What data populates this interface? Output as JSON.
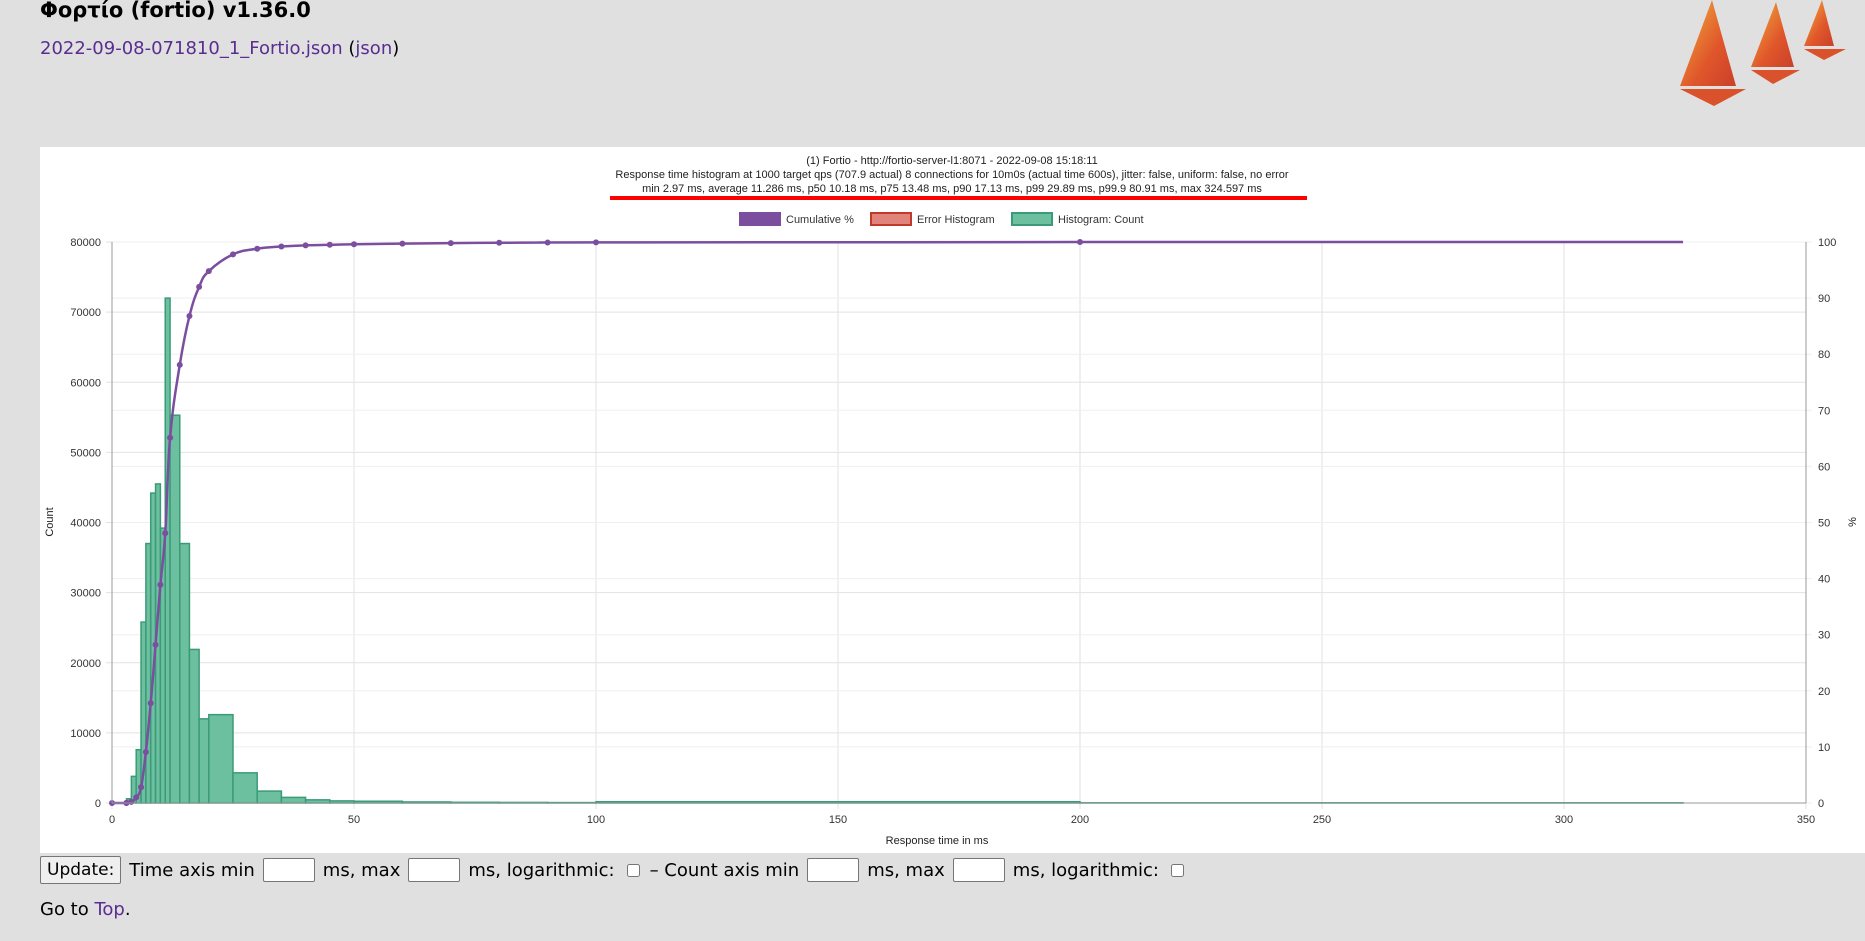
{
  "header": {
    "title": "Φορτίο (fortio) v1.36.0",
    "file_link": "2022-09-08-071810_1_Fortio.json",
    "json_prefix": " (",
    "json_link": "json",
    "json_suffix": ")"
  },
  "controls": {
    "update_label": "Update:",
    "time_min_label": "Time axis min",
    "time_max_label": "ms, max",
    "time_log_label": "ms, logarithmic:",
    "separator": "– Count axis min",
    "count_max_label": "ms, max",
    "count_log_label": "ms, logarithmic:"
  },
  "footer": {
    "goto_text": "Go to ",
    "top_link": "Top",
    "goto_end": "."
  },
  "colors": {
    "cumulative": "#7b4ea0",
    "histogram_fill": "#6cbf9f",
    "histogram_border": "#3b9b78",
    "error_fill": "#e0847b",
    "error_border": "#c0392b",
    "highlight_line": "#ff0000",
    "link": "#5a2d91"
  },
  "chart_data": {
    "type": "bar",
    "title_lines": [
      "(1) Fortio - http://fortio-server-l1:8071 - 2022-09-08 15:18:11",
      "Response time histogram at 1000 target qps (707.9 actual) 8 connections for 10m0s (actual time 600s), jitter: false, uniform: false, no error",
      "min 2.97 ms, average 11.286 ms, p50 10.18 ms, p75 13.48 ms, p90 17.13 ms, p99 29.89 ms, p99.9 80.91 ms, max 324.597 ms"
    ],
    "legend": [
      "Cumulative %",
      "Error Histogram",
      "Histogram: Count"
    ],
    "legend_position": "top",
    "xlabel": "Response time in ms",
    "ylabel": "Count",
    "y2label": "%",
    "xlim": [
      0,
      350
    ],
    "ylim": [
      0,
      80000
    ],
    "y2lim": [
      0,
      100
    ],
    "x_ticks": [
      0,
      50,
      100,
      150,
      200,
      250,
      300,
      350
    ],
    "y_ticks": [
      0,
      10000,
      20000,
      30000,
      40000,
      50000,
      60000,
      70000,
      80000
    ],
    "y2_ticks": [
      0,
      10,
      20,
      30,
      40,
      50,
      60,
      70,
      80,
      90,
      100
    ],
    "grid": true,
    "histogram_count": [
      {
        "x0": 2.97,
        "x1": 3,
        "y": 200
      },
      {
        "x0": 3,
        "x1": 4,
        "y": 600
      },
      {
        "x0": 4,
        "x1": 5,
        "y": 3800
      },
      {
        "x0": 5,
        "x1": 6,
        "y": 7600
      },
      {
        "x0": 6,
        "x1": 7,
        "y": 25800
      },
      {
        "x0": 7,
        "x1": 8,
        "y": 37000
      },
      {
        "x0": 8,
        "x1": 9,
        "y": 44200
      },
      {
        "x0": 9,
        "x1": 10,
        "y": 45500
      },
      {
        "x0": 10,
        "x1": 11,
        "y": 39200
      },
      {
        "x0": 11,
        "x1": 12,
        "y": 72000
      },
      {
        "x0": 12,
        "x1": 14,
        "y": 55300
      },
      {
        "x0": 14,
        "x1": 16,
        "y": 37000
      },
      {
        "x0": 16,
        "x1": 18,
        "y": 21900
      },
      {
        "x0": 18,
        "x1": 20,
        "y": 12000
      },
      {
        "x0": 20,
        "x1": 25,
        "y": 12600
      },
      {
        "x0": 25,
        "x1": 30,
        "y": 4300
      },
      {
        "x0": 30,
        "x1": 35,
        "y": 1700
      },
      {
        "x0": 35,
        "x1": 40,
        "y": 800
      },
      {
        "x0": 40,
        "x1": 45,
        "y": 450
      },
      {
        "x0": 45,
        "x1": 50,
        "y": 300
      },
      {
        "x0": 50,
        "x1": 60,
        "y": 250
      },
      {
        "x0": 60,
        "x1": 70,
        "y": 150
      },
      {
        "x0": 70,
        "x1": 80,
        "y": 100
      },
      {
        "x0": 80,
        "x1": 90,
        "y": 80
      },
      {
        "x0": 90,
        "x1": 100,
        "y": 60
      },
      {
        "x0": 100,
        "x1": 200,
        "y": 180
      },
      {
        "x0": 200,
        "x1": 324.597,
        "y": 30
      }
    ],
    "cumulative_percent": [
      {
        "x": 0,
        "y": 0
      },
      {
        "x": 2.97,
        "y": 0
      },
      {
        "x": 3,
        "y": 0.03
      },
      {
        "x": 4,
        "y": 0.2
      },
      {
        "x": 5,
        "y": 1.0
      },
      {
        "x": 6,
        "y": 2.8
      },
      {
        "x": 7,
        "y": 9.1
      },
      {
        "x": 8,
        "y": 17.8
      },
      {
        "x": 9,
        "y": 28.2
      },
      {
        "x": 10,
        "y": 38.9
      },
      {
        "x": 11,
        "y": 48.1
      },
      {
        "x": 12,
        "y": 65.1
      },
      {
        "x": 14,
        "y": 78.1
      },
      {
        "x": 16,
        "y": 86.8
      },
      {
        "x": 18,
        "y": 92.0
      },
      {
        "x": 20,
        "y": 94.8
      },
      {
        "x": 25,
        "y": 97.8
      },
      {
        "x": 30,
        "y": 98.8
      },
      {
        "x": 35,
        "y": 99.2
      },
      {
        "x": 40,
        "y": 99.4
      },
      {
        "x": 45,
        "y": 99.5
      },
      {
        "x": 50,
        "y": 99.6
      },
      {
        "x": 60,
        "y": 99.72
      },
      {
        "x": 70,
        "y": 99.8
      },
      {
        "x": 80,
        "y": 99.86
      },
      {
        "x": 90,
        "y": 99.9
      },
      {
        "x": 100,
        "y": 99.93
      },
      {
        "x": 200,
        "y": 99.99
      },
      {
        "x": 324.597,
        "y": 100
      }
    ]
  }
}
